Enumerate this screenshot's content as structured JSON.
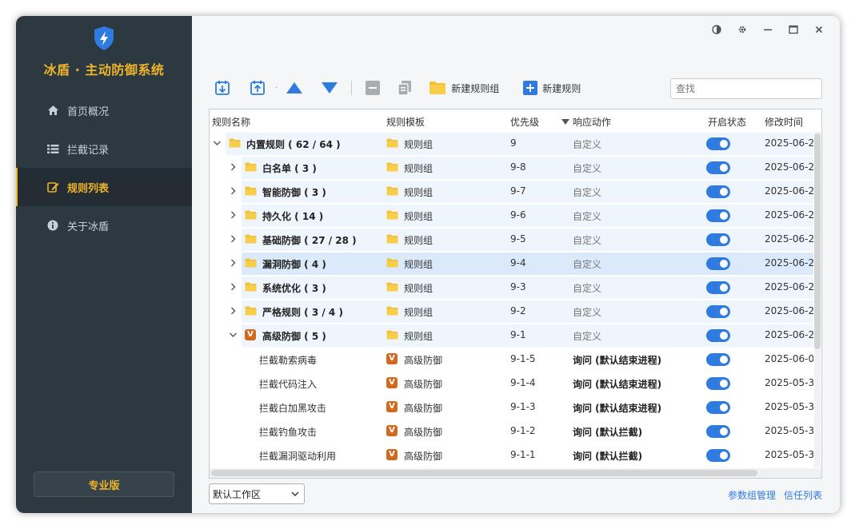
{
  "app": {
    "title": "冰盾 · 主动防御系统",
    "brand_color": "#f0b42a",
    "accent_color": "#2f7be0"
  },
  "sidebar": {
    "items": [
      {
        "label": "首页概况",
        "icon": "home-icon",
        "active": false
      },
      {
        "label": "拦截记录",
        "icon": "list-icon",
        "active": false
      },
      {
        "label": "规则列表",
        "icon": "edit-icon",
        "active": true
      },
      {
        "label": "关于冰盾",
        "icon": "info-icon",
        "active": false
      }
    ],
    "pro_label": "专业版"
  },
  "window_controls": [
    "theme-icon",
    "gear-icon",
    "minimize-icon",
    "maximize-icon",
    "close-icon"
  ],
  "toolbar": {
    "new_group_label": "新建规则组",
    "new_rule_label": "新建规则",
    "search_placeholder": "查找"
  },
  "table": {
    "columns": [
      "规则名称",
      "规则模板",
      "优先级",
      "响应动作",
      "开启状态",
      "修改时间"
    ],
    "rows": [
      {
        "level": 0,
        "expanded": true,
        "icon": "folder",
        "name": "内置规则 ( 62 / 64 )",
        "template_icon": "folder",
        "template": "规则组",
        "priority": "9",
        "action": "自定义",
        "enabled": true,
        "modified": "2025-06-2"
      },
      {
        "level": 1,
        "expanded": false,
        "icon": "folder",
        "name": "白名单 ( 3 )",
        "template_icon": "folder",
        "template": "规则组",
        "priority": "9-8",
        "action": "自定义",
        "enabled": true,
        "modified": "2025-06-2"
      },
      {
        "level": 1,
        "expanded": false,
        "icon": "folder",
        "name": "智能防御 ( 3 )",
        "template_icon": "folder",
        "template": "规则组",
        "priority": "9-7",
        "action": "自定义",
        "enabled": true,
        "modified": "2025-06-2"
      },
      {
        "level": 1,
        "expanded": false,
        "icon": "folder",
        "name": "持久化 ( 14 )",
        "template_icon": "folder",
        "template": "规则组",
        "priority": "9-6",
        "action": "自定义",
        "enabled": true,
        "modified": "2025-06-2"
      },
      {
        "level": 1,
        "expanded": false,
        "icon": "folder",
        "name": "基础防御 ( 27 / 28 )",
        "template_icon": "folder",
        "template": "规则组",
        "priority": "9-5",
        "action": "自定义",
        "enabled": true,
        "modified": "2025-06-2"
      },
      {
        "level": 1,
        "expanded": false,
        "icon": "folder",
        "name": "漏洞防御 ( 4 )",
        "template_icon": "folder",
        "template": "规则组",
        "priority": "9-4",
        "action": "自定义",
        "enabled": true,
        "modified": "2025-06-2",
        "selected": true
      },
      {
        "level": 1,
        "expanded": false,
        "icon": "folder",
        "name": "系统优化 ( 3 )",
        "template_icon": "folder",
        "template": "规则组",
        "priority": "9-3",
        "action": "自定义",
        "enabled": true,
        "modified": "2025-06-2"
      },
      {
        "level": 1,
        "expanded": false,
        "icon": "folder",
        "name": "严格规则 ( 3 / 4 )",
        "template_icon": "folder",
        "template": "规则组",
        "priority": "9-2",
        "action": "自定义",
        "enabled": true,
        "modified": "2025-06-2"
      },
      {
        "level": 1,
        "expanded": true,
        "icon": "vbadge",
        "name": "高级防御 ( 5 )",
        "template_icon": "folder",
        "template": "规则组",
        "priority": "9-1",
        "action": "自定义",
        "enabled": true,
        "modified": "2025-06-2"
      },
      {
        "level": 2,
        "icon": "none",
        "name": "拦截勒索病毒",
        "template_icon": "vbadge",
        "template": "高级防御",
        "priority": "9-1-5",
        "action": "询问 (默认结束进程)",
        "action_bold": true,
        "enabled": true,
        "modified": "2025-06-0"
      },
      {
        "level": 2,
        "icon": "none",
        "name": "拦截代码注入",
        "template_icon": "vbadge",
        "template": "高级防御",
        "priority": "9-1-4",
        "action": "询问 (默认结束进程)",
        "action_bold": true,
        "enabled": true,
        "modified": "2025-05-30"
      },
      {
        "level": 2,
        "icon": "none",
        "name": "拦截白加黑攻击",
        "template_icon": "vbadge",
        "template": "高级防御",
        "priority": "9-1-3",
        "action": "询问 (默认结束进程)",
        "action_bold": true,
        "enabled": true,
        "modified": "2025-05-30"
      },
      {
        "level": 2,
        "icon": "none",
        "name": "拦截钓鱼攻击",
        "template_icon": "vbadge",
        "template": "高级防御",
        "priority": "9-1-2",
        "action": "询问 (默认拦截)",
        "action_bold": true,
        "enabled": true,
        "modified": "2025-05-30"
      },
      {
        "level": 2,
        "icon": "none",
        "name": "拦截漏洞驱动利用",
        "template_icon": "vbadge",
        "template": "高级防御",
        "priority": "9-1-1",
        "action": "询问 (默认拦截)",
        "action_bold": true,
        "enabled": true,
        "modified": "2025-05-30"
      }
    ],
    "badge_letter": "V"
  },
  "footer": {
    "workspace": "默认工作区",
    "links": [
      "参数组管理",
      "信任列表"
    ]
  }
}
